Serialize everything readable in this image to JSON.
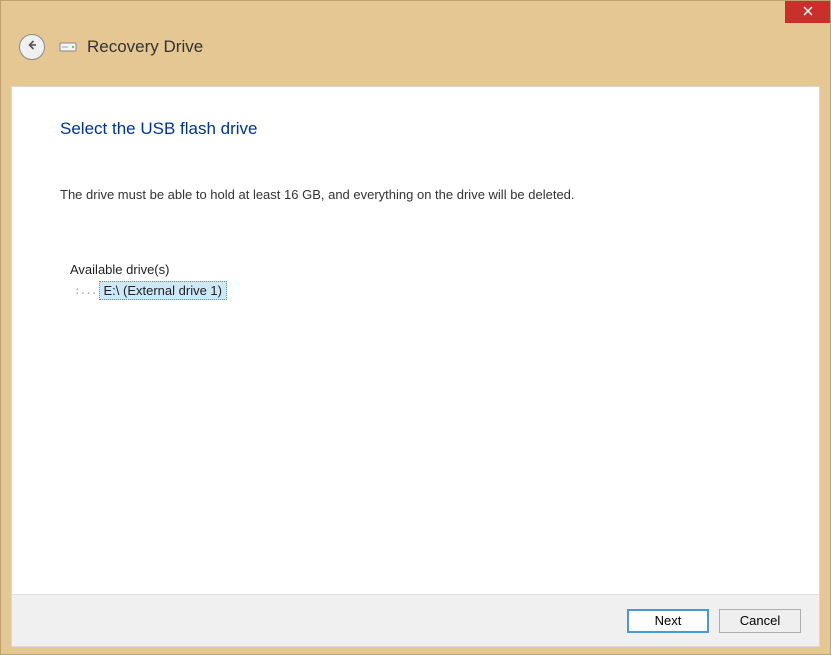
{
  "window": {
    "app_title": "Recovery Drive"
  },
  "page": {
    "heading": "Select the USB flash drive",
    "instruction": "The drive must be able to hold at least 16 GB, and everything on the drive will be deleted."
  },
  "drives": {
    "label": "Available drive(s)",
    "items": [
      {
        "display": "E:\\ (External drive 1)"
      }
    ]
  },
  "buttons": {
    "next": "Next",
    "cancel": "Cancel"
  }
}
